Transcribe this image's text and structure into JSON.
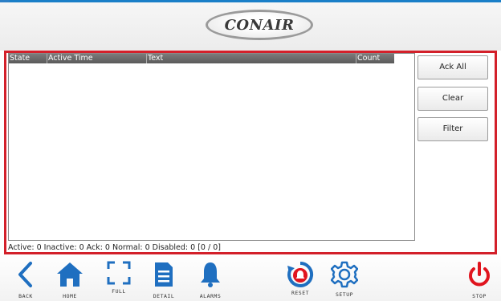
{
  "header": {
    "logo_text": "CONAIR"
  },
  "alarm_table": {
    "columns": [
      "State",
      "Active Time",
      "Text",
      "Count"
    ],
    "rows": []
  },
  "status_bar": {
    "text": "Active: 0 Inactive: 0 Ack: 0 Normal: 0 Disabled: 0 [0 / 0]"
  },
  "side_buttons": {
    "ack_all": "Ack All",
    "clear": "Clear",
    "filter": "Filter"
  },
  "toolbar": {
    "back": "BACK",
    "home": "HOME",
    "full": "FULL",
    "detail": "DETAIL",
    "alarms": "ALARMS",
    "reset": "RESET",
    "setup": "SETUP",
    "stop": "STOP"
  },
  "colors": {
    "accent_blue": "#1f6fc0",
    "frame_red": "#d3202a",
    "stop_red": "#e0141e"
  }
}
